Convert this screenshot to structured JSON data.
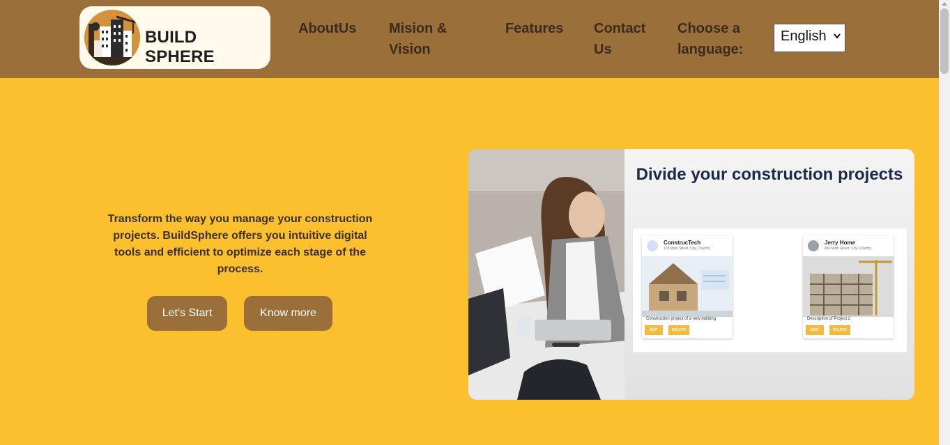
{
  "brand": {
    "name": "BUILD SPHERE"
  },
  "nav": {
    "links": [
      {
        "label": "AboutUs"
      },
      {
        "label": "Mision &\nVision"
      },
      {
        "label": "Features"
      },
      {
        "label": "Contact\nUs"
      }
    ],
    "language_label": "Choose a\nlanguage:",
    "language_value": "English"
  },
  "hero": {
    "text": "Transform the way you manage your construction projects. BuildSphere offers you intuitive digital tools and efficient to optimize each stage of the process.",
    "buttons": {
      "start": "Let's Start",
      "more": "Know more"
    }
  },
  "showcase": {
    "title": "Divide your construction projects",
    "projects": [
      {
        "name": "ConstrucTech",
        "address": "123 Main Street, City, Country",
        "description": "Construction project of a new building",
        "edit": "EDIT",
        "delete": "DELETE"
      },
      {
        "name": "Jerry Home",
        "address": "456 Main Street, City, Country",
        "description": "Description of Project 2",
        "edit": "EDIT",
        "delete": "DELETE"
      }
    ]
  },
  "colors": {
    "navbar": "#9b6f3a",
    "background": "#fcc02f",
    "button": "#9b6f3a",
    "logo_bg": "#fffaec"
  }
}
